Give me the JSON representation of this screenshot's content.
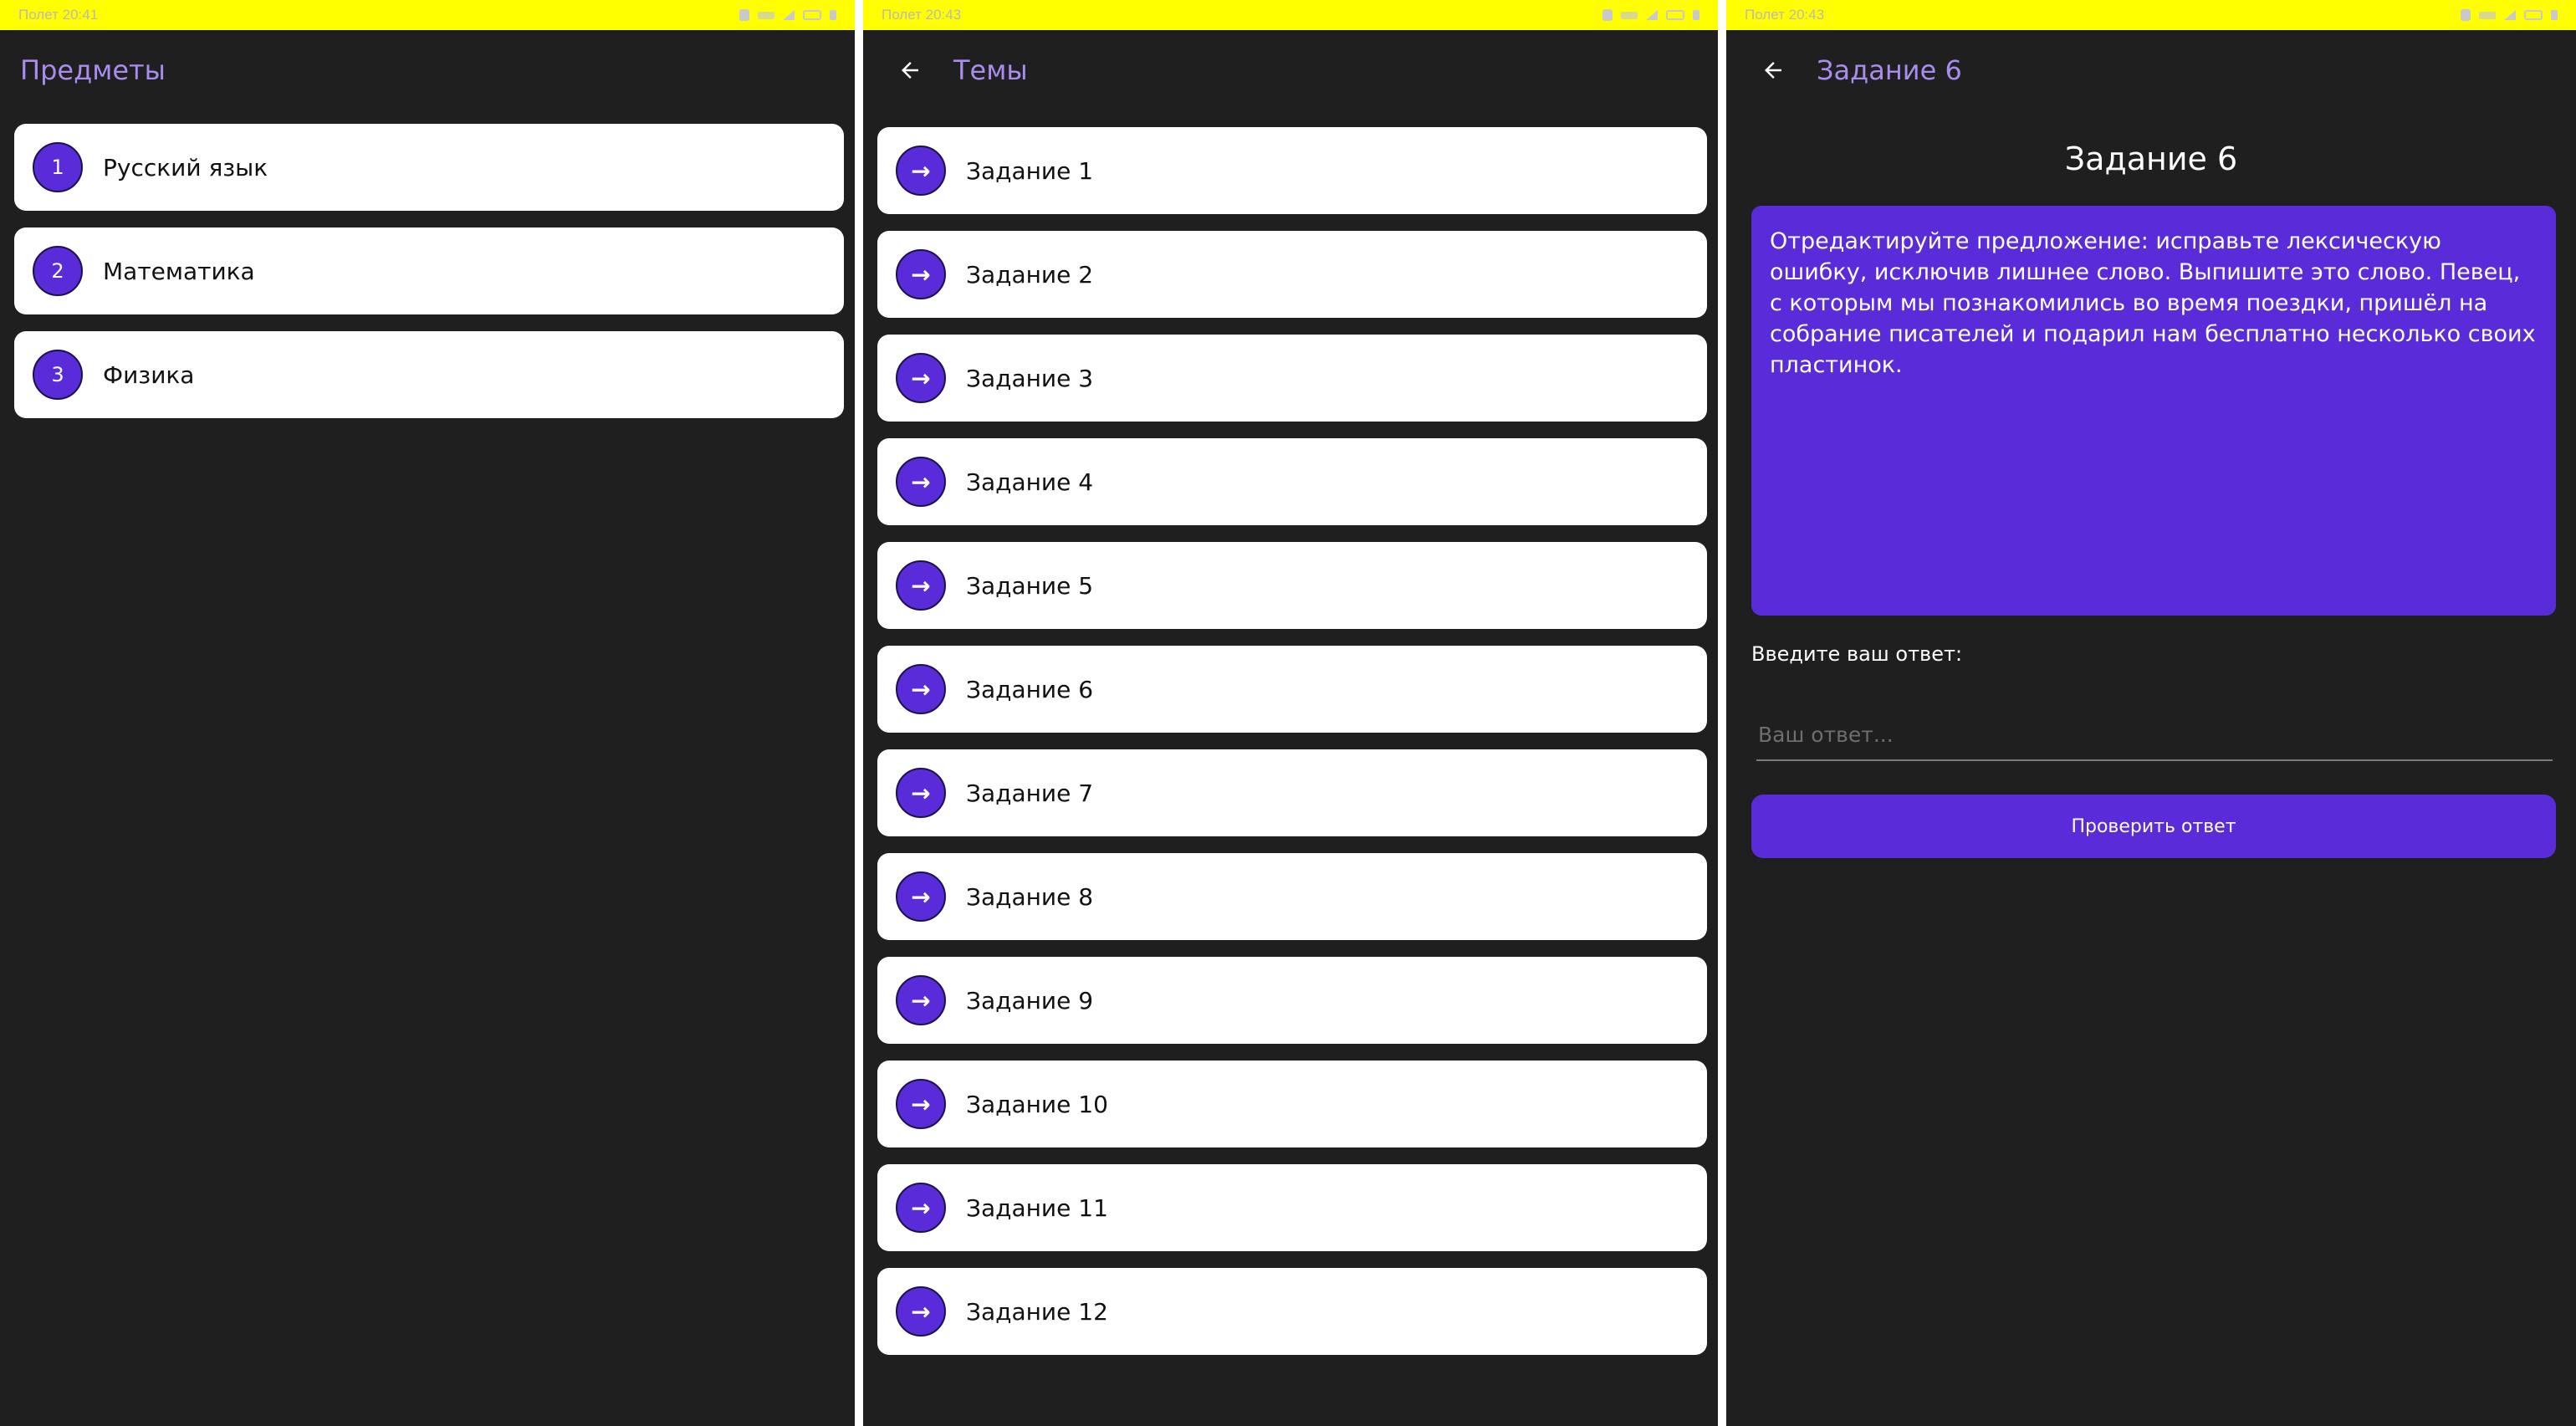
{
  "status_bar": {
    "text": "Полет 20:41",
    "text_2": "Полет 20:43",
    "text_3": "Полет 20:43",
    "background": "#ffff00"
  },
  "subjects_screen": {
    "title": "Предметы",
    "items": [
      {
        "number": "1",
        "label": "Русский язык"
      },
      {
        "number": "2",
        "label": "Математика"
      },
      {
        "number": "3",
        "label": "Физика"
      }
    ]
  },
  "topics_screen": {
    "title": "Темы",
    "back_icon": "arrow-back-icon",
    "item_icon": "arrow-right-icon",
    "arrow_glyph": "→",
    "items": [
      {
        "label": "Задание 1"
      },
      {
        "label": "Задание 2"
      },
      {
        "label": "Задание 3"
      },
      {
        "label": "Задание 4"
      },
      {
        "label": "Задание 5"
      },
      {
        "label": "Задание 6"
      },
      {
        "label": "Задание 7"
      },
      {
        "label": "Задание 8"
      },
      {
        "label": "Задание 9"
      },
      {
        "label": "Задание 10"
      },
      {
        "label": "Задание 11"
      },
      {
        "label": "Задание 12"
      }
    ]
  },
  "task_screen": {
    "title": "Задание 6",
    "heading": "Задание 6",
    "question": "Отредактируйте предложение: исправьте лексическую ошибку, исключив лишнее слово. Выпишите это слово.  Певец, с которым мы познакомились во время поездки, пришёл на собрание писателей и подарил нам бесплатно несколько своих пластинок.",
    "answer_label": "Введите ваш ответ:",
    "answer_value": "",
    "answer_placeholder": "Ваш ответ...",
    "check_button": "Проверить ответ"
  },
  "colors": {
    "accent": "#5a2bd9",
    "title": "#a98cf0",
    "background": "#1f1f1f",
    "card": "#ffffff"
  }
}
